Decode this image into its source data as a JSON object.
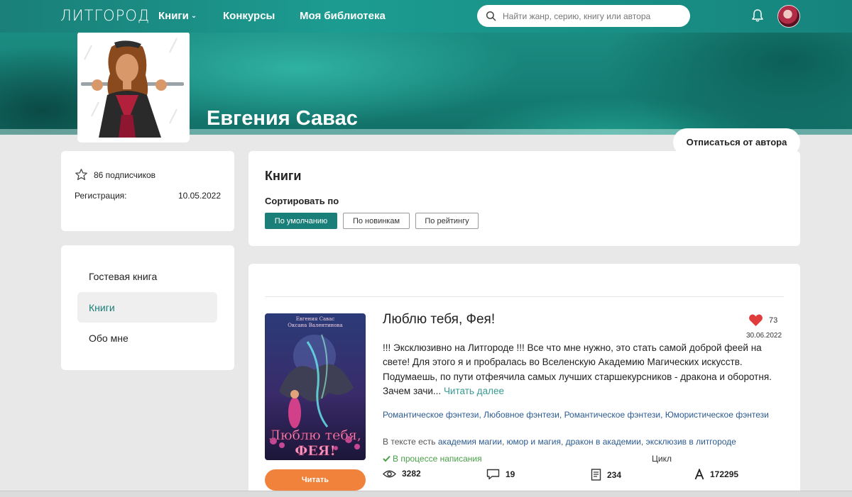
{
  "header": {
    "logo": "ЛИТГОРОД",
    "nav": {
      "books": "Книги",
      "contests": "Конкурсы",
      "library": "Моя библиотека"
    },
    "search_placeholder": "Найти жанр, серию, книгу или автора"
  },
  "author": {
    "name": "Евгения Савас",
    "unsubscribe_label": "Отписаться от автора"
  },
  "stats": {
    "subscribers": "86 подписчиков",
    "registration_label": "Регистрация:",
    "registration_date": "10.05.2022"
  },
  "menu": {
    "guestbook": "Гостевая книга",
    "books": "Книги",
    "about": "Обо мне",
    "active": "books"
  },
  "books_section": {
    "title": "Книги",
    "sort_label": "Сортировать по",
    "sort_options": [
      "По умолчанию",
      "По новинкам",
      "По рейтингу"
    ],
    "sort_selected": "По умолчанию"
  },
  "book": {
    "title": "Люблю тебя, Фея!",
    "cover_author_line1": "Евгения Савас",
    "cover_author_line2": "Оксана Валентинова",
    "cover_title_line1": "Люблю тебя,",
    "cover_title_line2": "ФЕЯ!",
    "likes": "73",
    "date": "30.06.2022",
    "description": "!!! Эксклюзивно на Литгороде !!! Все что мне нужно, это стать самой доброй феей на свете! Для этого я и пробралась во Вселенскую Академию Магических искусств. Подумаешь, по пути отфеячила самых лучших старшекурсников - дракона и оборотня. Зачем зачи...",
    "read_more": "Читать далее",
    "genres": [
      "Романтическое фэнтези",
      "Любовное фэнтези",
      "Романтическое фэнтези",
      "Юмористическое фэнтези"
    ],
    "tags_prefix": "В тексте есть",
    "tags": [
      "академия магии",
      "юмор и магия",
      "дракон в академии",
      "эксклюзив в литгороде"
    ],
    "status": "В процессе написания",
    "cycle_label": "Цикл",
    "views": "3282",
    "comments": "19",
    "pages": "234",
    "chars": "172295",
    "read_label": "Читать"
  },
  "colors": {
    "brand_teal": "#1a7f78",
    "read_button": "#f0823c",
    "like_heart": "#e03c3c",
    "status_green": "#4aa04a",
    "link_blue": "#2c5b92"
  }
}
